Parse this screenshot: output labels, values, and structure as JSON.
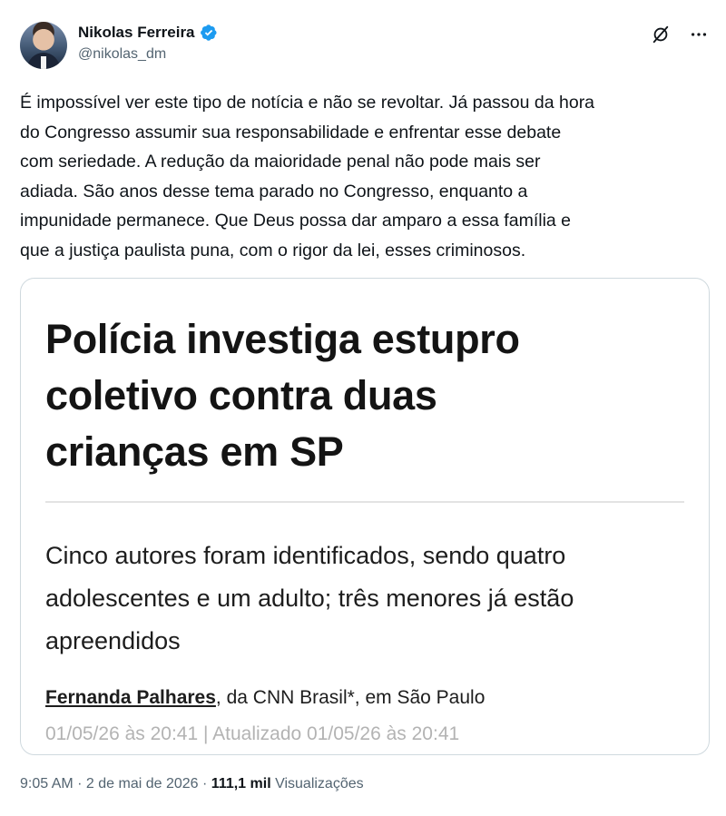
{
  "author": {
    "display_name": "Nikolas Ferreira",
    "handle": "@nikolas_dm",
    "verified": true
  },
  "colors": {
    "verified_badge": "#1d9bf0",
    "text_primary": "#0f1419",
    "text_secondary": "#536471",
    "border": "#cfd9de"
  },
  "actions": {
    "grok_icon": "grok-icon",
    "more_icon": "more-icon"
  },
  "tweet": {
    "lines": [
      "É impossível ver este tipo de notícia e não se revoltar. Já passou da hora",
      "do Congresso assumir sua responsabilidade e enfrentar esse debate",
      "com seriedade. A redução da maioridade penal não pode mais ser",
      "adiada. São anos desse tema parado no Congresso, enquanto a",
      "impunidade permanece. Que Deus possa dar amparo a essa família e",
      "que a justiça paulista puna, com o rigor da lei, esses criminosos."
    ]
  },
  "card": {
    "title_lines": [
      "Polícia investiga estupro",
      "coletivo contra duas",
      "crianças em SP"
    ],
    "subtitle_lines": [
      "Cinco autores foram identificados, sendo quatro",
      "adolescentes e um adulto; três menores já estão",
      "apreendidos"
    ],
    "author": "Fernanda Palhares",
    "outlet_text": ", da CNN Brasil*, em São Paulo",
    "published": "01/05/26 às 20:41",
    "separator": " | ",
    "updated": "Atualizado 01/05/26 às 20:41"
  },
  "meta": {
    "time": "9:05 AM",
    "dot1": " · ",
    "date": "2 de mai de 2026",
    "dot2": " · ",
    "views_count": "111,1 mil",
    "views_label": " Visualizações"
  }
}
